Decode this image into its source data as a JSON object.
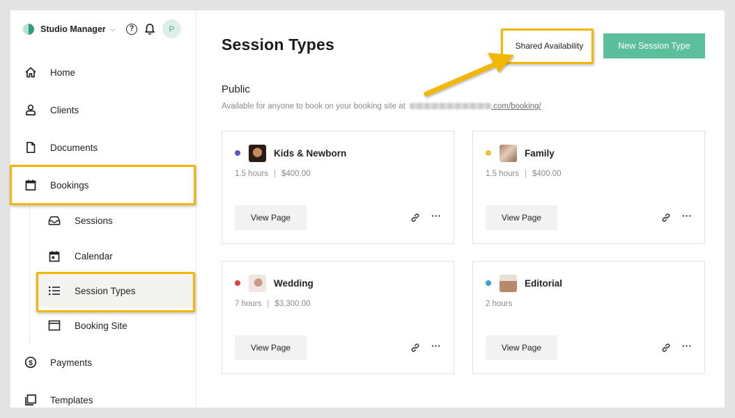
{
  "header": {
    "brand": "Studio Manager",
    "brand_caret": "⌵",
    "help_glyph": "?",
    "avatar_initial": "P"
  },
  "sidebar": {
    "items": [
      {
        "label": "Home",
        "icon": "home-icon"
      },
      {
        "label": "Clients",
        "icon": "person-icon"
      },
      {
        "label": "Documents",
        "icon": "document-icon"
      },
      {
        "label": "Bookings",
        "icon": "calendar-icon"
      },
      {
        "label": "Payments",
        "icon": "dollar-icon"
      },
      {
        "label": "Templates",
        "icon": "templates-icon"
      }
    ],
    "sub_items": [
      {
        "label": "Sessions",
        "icon": "inbox-icon"
      },
      {
        "label": "Calendar",
        "icon": "calendar-day-icon"
      },
      {
        "label": "Session Types",
        "icon": "list-icon"
      },
      {
        "label": "Booking Site",
        "icon": "browser-icon"
      }
    ]
  },
  "main": {
    "title": "Session Types",
    "shared_availability_label": "Shared Availability",
    "new_session_type_label": "New Session Type",
    "section": {
      "title": "Public",
      "description_prefix": "Available for anyone to book on your booking site at",
      "link_suffix": ".com/booking/"
    },
    "cards": [
      {
        "name": "Kids & Newborn",
        "duration": "1.5 hours",
        "price": "$400.00",
        "dot_color": "#5b57c7",
        "view_label": "View Page"
      },
      {
        "name": "Family",
        "duration": "1.5 hours",
        "price": "$400.00",
        "dot_color": "#e9c130",
        "view_label": "View Page"
      },
      {
        "name": "Wedding",
        "duration": "7 hours",
        "price": "$3,300.00",
        "dot_color": "#d8414a",
        "view_label": "View Page"
      },
      {
        "name": "Editorial",
        "duration": "2 hours",
        "price": "",
        "dot_color": "#3d9be0",
        "view_label": "View Page"
      }
    ],
    "separator": "|",
    "more_glyph": "···"
  },
  "colors": {
    "accent": "#5cbf9b",
    "highlight": "#f2b705"
  }
}
